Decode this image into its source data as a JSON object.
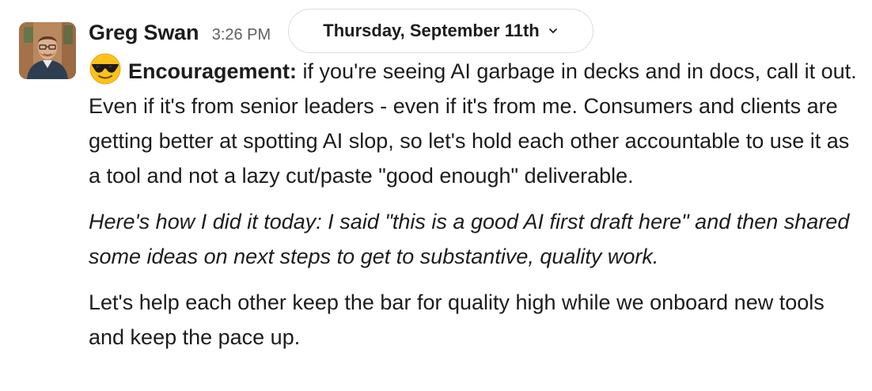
{
  "message": {
    "sender": "Greg Swan",
    "timestamp": "3:26 PM",
    "date_divider": "Thursday, September 11th",
    "emoji": "sunglasses-face",
    "lead_label": "Encouragement:",
    "paragraph_1": " if you're seeing AI garbage in decks and in docs, call it out. Even if it's from senior leaders - even if it's from me. Consumers and clients are getting better at spotting AI slop, so let's hold each other accountable to use it as a tool and not a lazy cut/paste \"good enough\" deliverable.",
    "paragraph_2": "Here's how I did it today:  I said \"this is a good AI first draft here\" and then shared some ideas on next steps to get to substantive, quality work.",
    "paragraph_3": "Let's help each other keep the bar for quality high while we onboard new tools and keep the pace up."
  },
  "colors": {
    "text": "#1d1c1d",
    "muted": "#616061",
    "pill_border": "#dddddd"
  }
}
